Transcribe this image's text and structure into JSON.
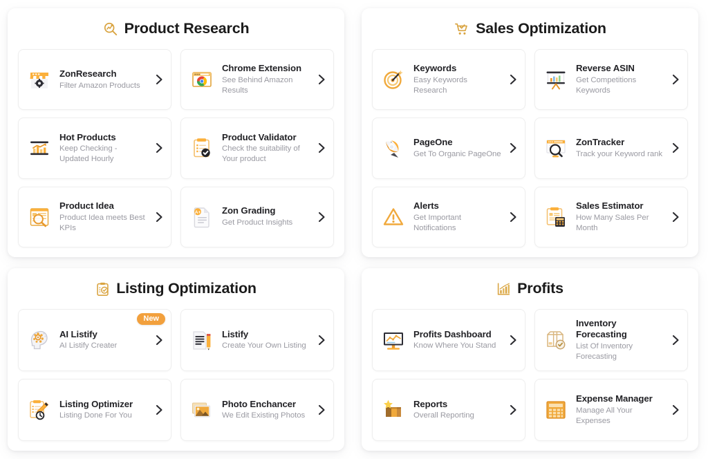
{
  "colors": {
    "accent": "#F2A03D",
    "accent_light": "#F6C26B",
    "title": "#1B1B1B",
    "desc": "#9A9AA2",
    "badge_bg": "#F2A03D",
    "badge_text": "#FFFFFF",
    "panel_bg": "#FFFFFF"
  },
  "panels": [
    {
      "id": "product-research",
      "title": "Product Research",
      "icon": "magnifier-trend-icon",
      "tiles": [
        {
          "name": "ZonResearch",
          "desc": "Filter Amazon Products",
          "icon": "storefront-gear-icon",
          "badge": null
        },
        {
          "name": "Chrome Extension",
          "desc": "See Behind Amazon Results",
          "icon": "browser-chrome-icon",
          "badge": null
        },
        {
          "name": "Hot Products",
          "desc": "Keep Checking - Updated Hourly",
          "icon": "bar-chart-trend-icon",
          "badge": null
        },
        {
          "name": "Product Validator",
          "desc": "Check the suitability of Your product",
          "icon": "clipboard-check-icon",
          "badge": null
        },
        {
          "name": "Product Idea",
          "desc": "Product Idea meets Best KPIs",
          "icon": "page-magnifier-icon",
          "badge": null
        },
        {
          "name": "Zon Grading",
          "desc": "Get Product Insights",
          "icon": "document-grade-icon",
          "badge": null
        }
      ]
    },
    {
      "id": "sales-optimization",
      "title": "Sales Optimization",
      "icon": "shopping-cart-check-icon",
      "tiles": [
        {
          "name": "Keywords",
          "desc": "Easy Keywords Research",
          "icon": "target-dart-icon",
          "badge": null
        },
        {
          "name": "Reverse ASIN",
          "desc": "Get Competitions Keywords",
          "icon": "presentation-chart-icon",
          "badge": null
        },
        {
          "name": "PageOne",
          "desc": "Get To Organic PageOne",
          "icon": "rocket-icon",
          "badge": null
        },
        {
          "name": "ZonTracker",
          "desc": "Track your Keyword rank",
          "icon": "browser-magnifier-icon",
          "badge": null
        },
        {
          "name": "Alerts",
          "desc": "Get Important Notifications",
          "icon": "warning-triangle-icon",
          "badge": null
        },
        {
          "name": "Sales Estimator",
          "desc": "How Many Sales Per Month",
          "icon": "clipboard-calculator-icon",
          "badge": null
        }
      ]
    },
    {
      "id": "listing-optimization",
      "title": "Listing Optimization",
      "icon": "clipboard-check-header-icon",
      "tiles": [
        {
          "name": "AI Listify",
          "desc": "AI Listify Creater",
          "icon": "head-gears-icon",
          "badge": "New"
        },
        {
          "name": "Listify",
          "desc": "Create Your Own Listing",
          "icon": "document-pencil-icon",
          "badge": null
        },
        {
          "name": "Listing Optimizer",
          "desc": "Listing Done For You",
          "icon": "clipboard-pencil-clock-icon",
          "badge": null
        },
        {
          "name": "Photo Enchancer",
          "desc": "We Edit Existing Photos",
          "icon": "photos-stack-icon",
          "badge": null
        }
      ]
    },
    {
      "id": "profits",
      "title": "Profits",
      "icon": "bar-chart-arrow-icon",
      "tiles": [
        {
          "name": "Profits Dashboard",
          "desc": "Know Where You Stand",
          "icon": "monitor-chart-icon",
          "badge": null
        },
        {
          "name": "Inventory Forecasting",
          "desc": "List Of Inventory Forecasting",
          "icon": "box-check-icon",
          "badge": null
        },
        {
          "name": "Reports",
          "desc": "Overall Reporting",
          "icon": "box-star-icon",
          "badge": null
        },
        {
          "name": "Expense Manager",
          "desc": "Manage All Your Expenses",
          "icon": "calculator-icon",
          "badge": null
        }
      ]
    }
  ]
}
